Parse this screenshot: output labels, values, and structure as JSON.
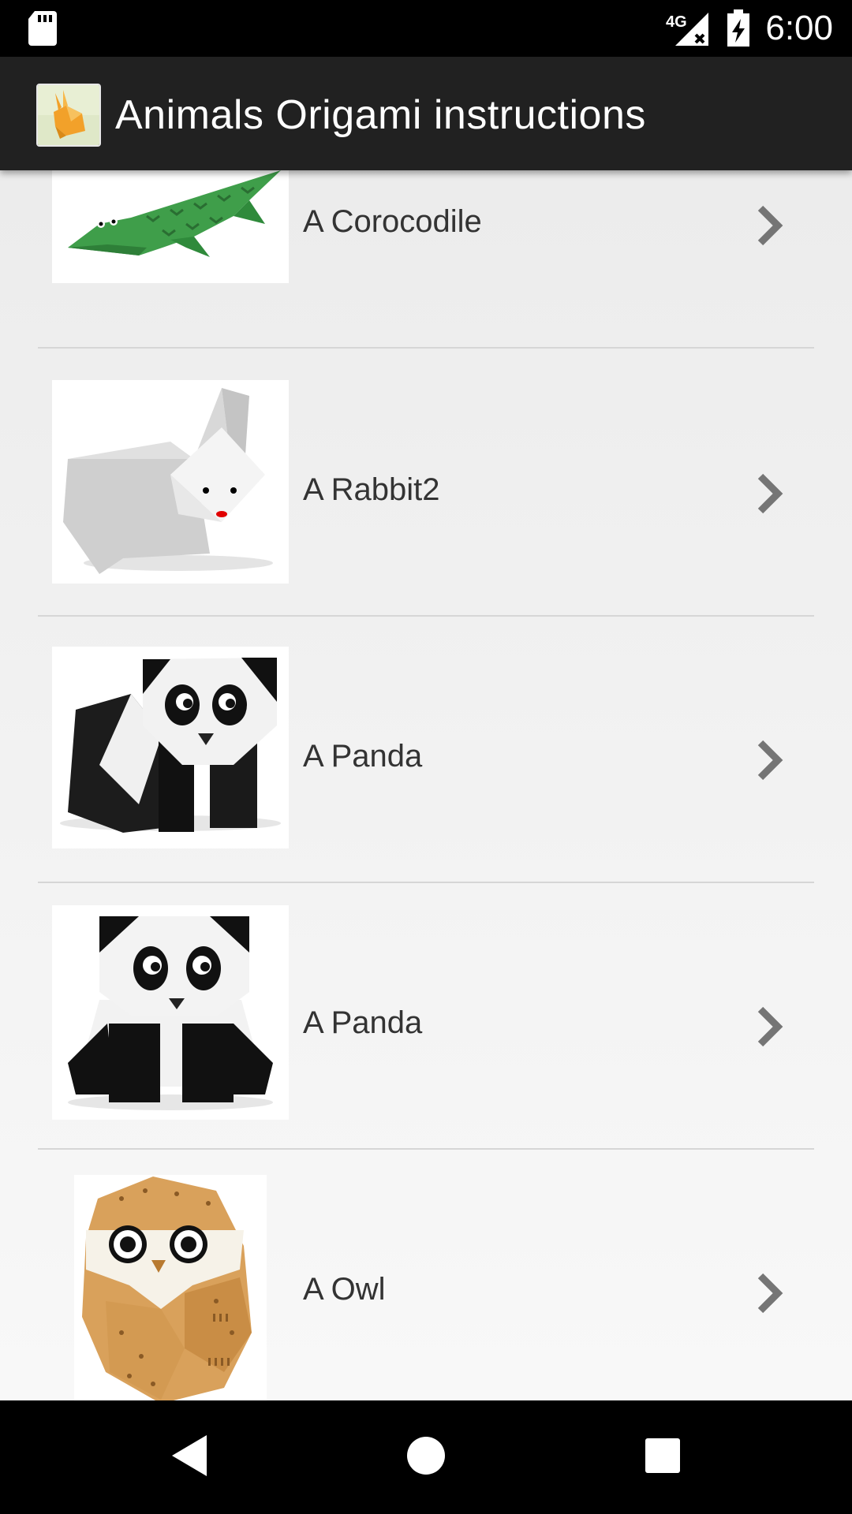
{
  "status_bar": {
    "time": "6:00",
    "network": "4G",
    "icons": [
      "sd-card-icon",
      "signal-icon",
      "battery-charging-icon"
    ]
  },
  "app_bar": {
    "title": "Animals Origami instructions",
    "icon": "origami-rabbit-app-icon"
  },
  "list": {
    "items": [
      {
        "label": "A Corocodile",
        "thumb": "origami-crocodile"
      },
      {
        "label": "A Rabbit2",
        "thumb": "origami-rabbit"
      },
      {
        "label": "A Panda",
        "thumb": "origami-panda"
      },
      {
        "label": "A Panda",
        "thumb": "origami-panda-sitting"
      },
      {
        "label": "A Owl",
        "thumb": "origami-owl"
      }
    ]
  },
  "nav_bar": {
    "buttons": [
      "back-icon",
      "home-icon",
      "recents-icon"
    ]
  },
  "colors": {
    "status_bar": "#000000",
    "app_bar": "#212121",
    "list_bg": "#f0f0f0",
    "text": "#333333",
    "chevron": "#757575"
  }
}
